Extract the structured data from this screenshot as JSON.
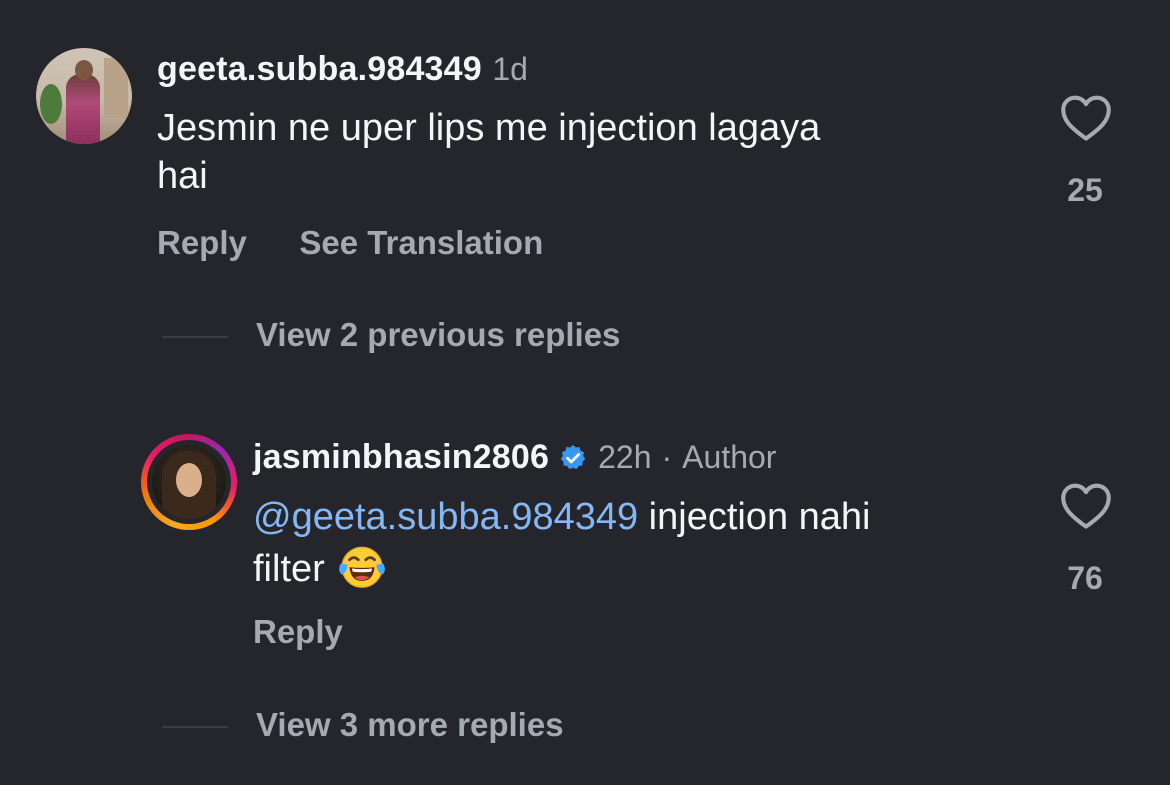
{
  "comments": [
    {
      "username": "geeta.subba.984349",
      "time": "1d",
      "text": "Jesmin  ne  uper lips me injection lagaya hai",
      "text_line1": "Jesmin  ne  uper lips me injection lagaya",
      "text_line2": "hai",
      "reply_label": "Reply",
      "translate_label": "See Translation",
      "like_count": "25"
    }
  ],
  "view_previous": "View 2 previous replies",
  "reply": {
    "username": "jasminbhasin2806",
    "verified_icon": "verified-badge-icon",
    "time": "22h",
    "separator": "·",
    "author_label": "Author",
    "mention": "@geeta.subba.984349",
    "text_after_mention": " injection nahi",
    "text_line2": "filter ",
    "emoji": "face-with-tears-of-joy",
    "reply_label": "Reply",
    "like_count": "76"
  },
  "view_more": "View 3 more replies",
  "colors": {
    "background": "#24262b",
    "primary_text": "#f4f5f7",
    "secondary_text": "#a6a9b1",
    "mention": "#86b7f5",
    "verified": "#3897f0"
  }
}
